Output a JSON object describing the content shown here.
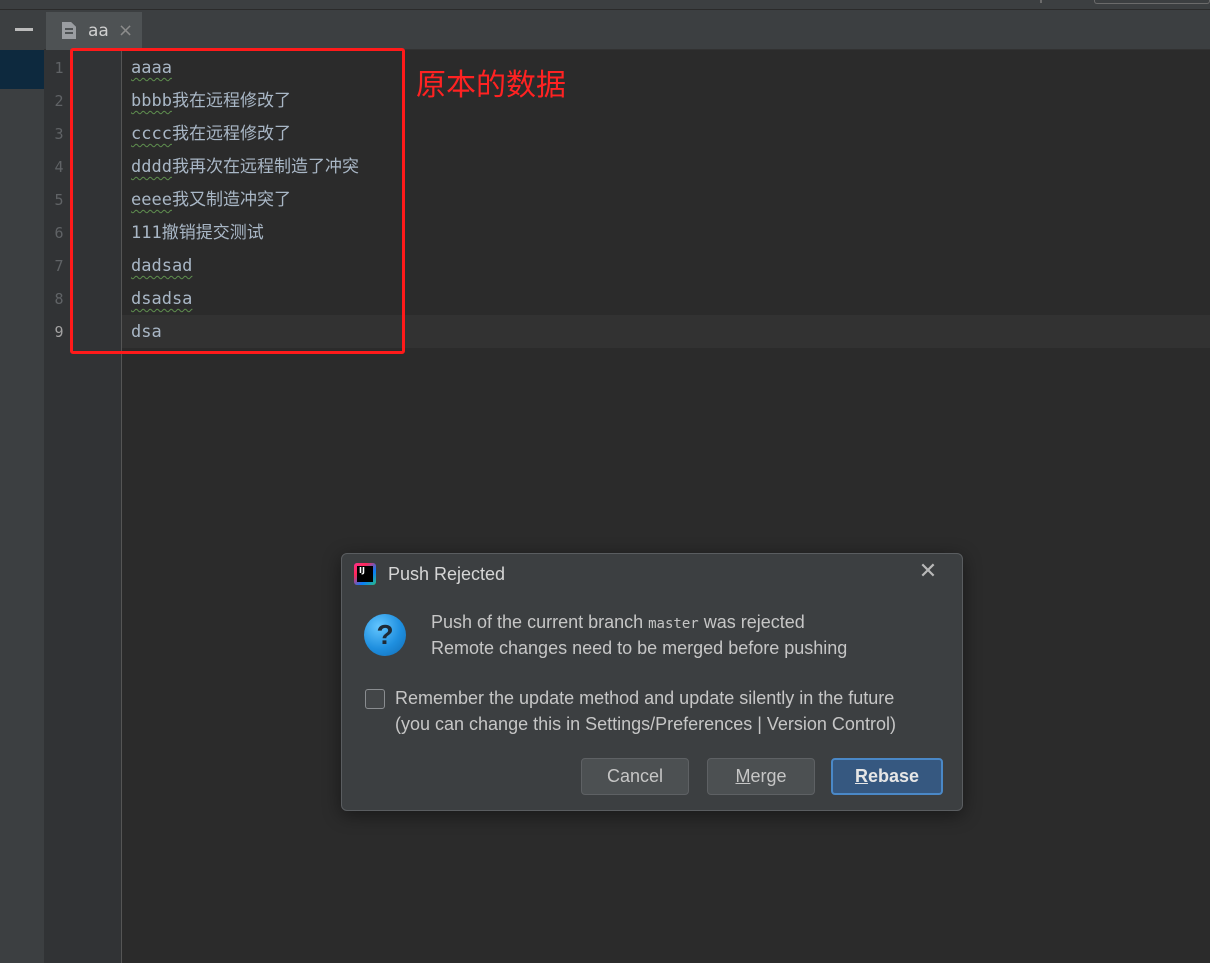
{
  "editor": {
    "tab": {
      "label": "aa",
      "close": "×"
    },
    "lines": [
      {
        "number": "1",
        "ascii": "aaaa",
        "cjk": ""
      },
      {
        "number": "2",
        "ascii": "bbbb",
        "cjk": "我在远程修改了"
      },
      {
        "number": "3",
        "ascii": "cccc",
        "cjk": "我在远程修改了"
      },
      {
        "number": "4",
        "ascii": "dddd",
        "cjk": "我再次在远程制造了冲突"
      },
      {
        "number": "5",
        "ascii": "eeee",
        "cjk": "我又制造冲突了"
      },
      {
        "number": "6",
        "ascii": "111",
        "cjk": "撤销提交测试"
      },
      {
        "number": "7",
        "ascii": "dadsad",
        "cjk": ""
      },
      {
        "number": "8",
        "ascii": "dsadsa",
        "cjk": ""
      },
      {
        "number": "9",
        "ascii": "dsa",
        "cjk": ""
      }
    ],
    "current_line": 9
  },
  "annotation": {
    "label": "原本的数据",
    "color": "#ff2222"
  },
  "dialog": {
    "title": "Push Rejected",
    "close": "✕",
    "icon": "question-icon",
    "message_prefix": "Push of the current branch ",
    "branch": "master",
    "message_suffix": " was rejected",
    "message_line2": "Remote changes need to be merged before pushing",
    "checkbox_checked": false,
    "checkbox_line1": "Remember the update method and update silently in the future",
    "checkbox_line2": "(you can change this in Settings/Preferences | Version Control)",
    "buttons": {
      "cancel": "Cancel",
      "merge_mnemonic": "M",
      "merge_rest": "erge",
      "rebase_mnemonic": "R",
      "rebase_rest": "ebase"
    }
  },
  "colors": {
    "editor_bg": "#2b2b2b",
    "panel_bg": "#3c3f41",
    "code_text": "#a9b7c6",
    "primary_button": "#365880"
  }
}
